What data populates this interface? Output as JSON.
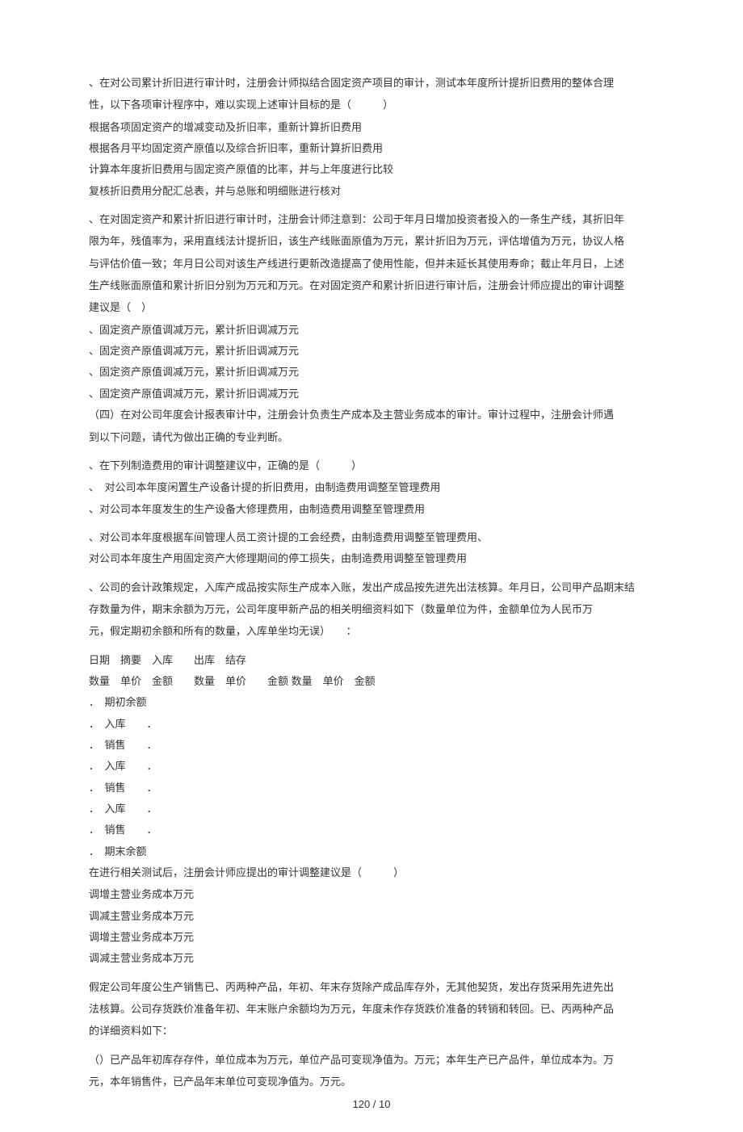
{
  "q1": {
    "stem1": "、在对公司累计折旧进行审计时，注册会计师拟结合固定资产项目的审计，测试本年度所计提折旧费用的整体合理",
    "stem2": "性，以下各项审计程序中，难以实现上述审计目标的是（　　　）",
    "a": "根据各项固定资产的增减变动及折旧率，重新计算折旧费用",
    "b": "根据各月平均固定资产原值以及综合折旧率，重新计算折旧费用",
    "c": "计算本年度折旧费用与固定资产原值的比率，并与上年度进行比较",
    "d": "复核折旧费用分配汇总表，并与总账和明细账进行核对"
  },
  "q2": {
    "stem1": "、在对固定资产和累计折旧进行审计时，注册会计师注意到：公司于年月日增加投资者投入的一条生产线，其折旧年",
    "stem2": "限为年，残值率为，采用直线法计提折旧，该生产线账面原值为万元，累计折旧为万元，评估增值为万元，协议人格",
    "stem3": "与评估价值一致；年月日公司对该生产线进行更新改造提高了使用性能，但并未延长其使用寿命；截止年月日，上述",
    "stem4": "生产线账面原值和累计折旧分别为万元和万元。在对固定资产和累计折旧进行审计后，注册会计师应提出的审计调整",
    "stem5": "建议是（　）",
    "a": "、固定资产原值调减万元，累计折旧调减万元",
    "b": "、固定资产原值调减万元，累计折旧调减万元",
    "c": "、固定资产原值调减万元，累计折旧调减万元",
    "d": "、固定资产原值调减万元，累计折旧调减万元"
  },
  "q3": {
    "intro1": "（四）在对公司年度会计报表审计中，注册会计负责生产成本及主营业务成本的审计。审计过程中，注册会计师遇",
    "intro2": "到以下问题，请代为做出正确的专业判断。",
    "stem": "、在下列制造费用的审计调整建议中，正确的是（　　　）",
    "a": "、　对公司本年度闲置生产设备计提的折旧费用，由制造费用调整至管理费用",
    "b": "、对公司本年度发生的生产设备大修理费用，由制造费用调整至管理费用",
    "c": "、对公司本年度根据车间管理人员工资计提的工会经费，由制造费用调整至管理费用、",
    "d": "对公司本年度生产用固定资产大修理期间的停工损失，由制造费用调整至管理费用"
  },
  "q4": {
    "stem1": "、公司的会计政策规定，入库产成品按实际生产成本入账，发出产成品按先进先出法核算。年月日，公司甲产品期末结",
    "stem2": "存数量为件，期末余额为万元，公司年度甲新产品的相关明细资料如下（数量单位为件，金额单位为人民币万",
    "stem3": "元，假定期初余额和所有的数量，入库单坐均无误）　　：",
    "th1": "日期　摘要　入库　　出库　结存",
    "th2": "数量　单价　金额　　数量　单价　　金额  数量　单价　金额",
    "r1": "．　期初余额",
    "r2": "．　入库　　．",
    "r3": "．　销售　　．",
    "r4": "．　入库　　．",
    "r5": "．　销售　　．",
    "r6": "．　入库　　．",
    "r7": "．　销售　　．",
    "r8": "．　期末余额",
    "tail": "在进行相关测试后，注册会计师应提出的审计调整建议是（　　　）",
    "a": "调增主营业务成本万元",
    "b": "调减主营业务成本万元",
    "c": "调增主营业务成本万元",
    "d": "调减主营业务成本万元"
  },
  "q5": {
    "stem1": "假定公司年度公生产销售已、丙两种产品，年初、年末存货除产成品库存外，无其他契货，发出存货采用先进先出",
    "stem2": "法核算。公司存货跌价准备年初、年末账户余额均为万元，年度未作存货跌价准备的转销和转回。已、丙两种产品",
    "stem3": "的详细资料如下：",
    "p1": "（）已产品年初库存存件，单位成本为万元，单位产品可变现净值为。万元；本年生产已产品件，单位成本为。万",
    "p2": "元，本年销售件，已产品年末单位可变现净值为。万元。"
  },
  "footer": "120 / 10"
}
